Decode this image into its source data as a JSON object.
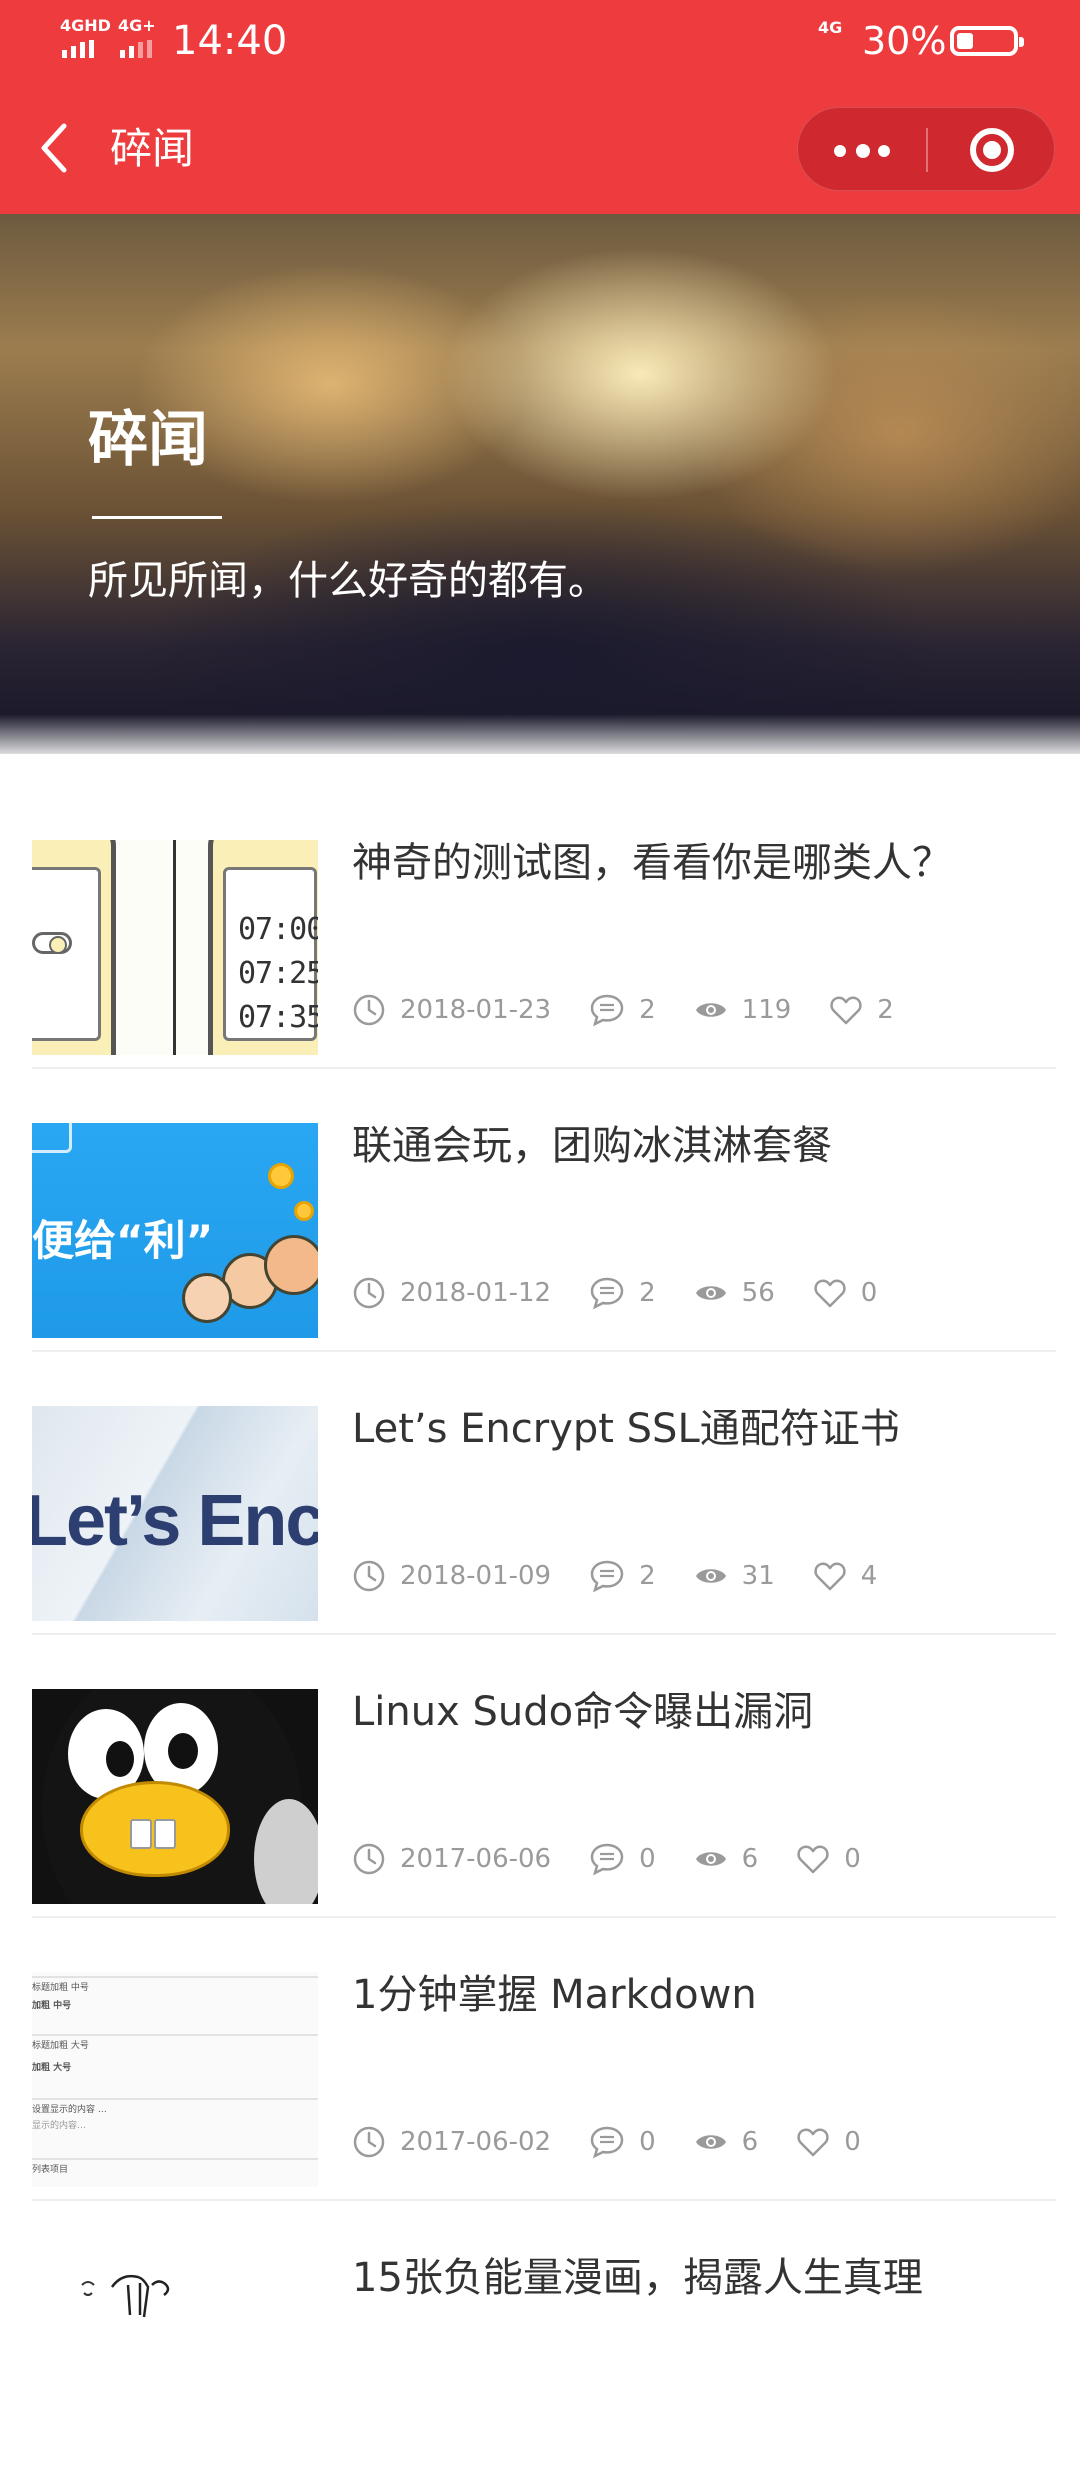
{
  "status_bar": {
    "signal_1": "4GHD",
    "signal_2": "4G+",
    "time": "14:40",
    "network_right": "4G",
    "battery_percent": "30%",
    "battery_level": 0.3
  },
  "nav": {
    "title": "碎闻"
  },
  "banner": {
    "title": "碎闻",
    "subtitle": "所见所闻，什么好奇的都有。"
  },
  "posts": [
    {
      "title": "神奇的测试图，看看你是哪类人？",
      "date": "2018-01-23",
      "comments": "2",
      "views": "119",
      "likes": "2",
      "thumb_clocks": [
        "07:00",
        "07:25",
        "07:35"
      ]
    },
    {
      "title": "联通会玩，团购冰淇淋套餐",
      "date": "2018-01-12",
      "comments": "2",
      "views": "56",
      "likes": "0",
      "thumb_text": "便给“利”"
    },
    {
      "title": "Let’s Encrypt SSL通配符证书",
      "date": "2018-01-09",
      "comments": "2",
      "views": "31",
      "likes": "4",
      "thumb_text": "Let’s Enc"
    },
    {
      "title": "Linux Sudo命令曝出漏洞",
      "date": "2017-06-06",
      "comments": "0",
      "views": "6",
      "likes": "0"
    },
    {
      "title": "1分钟掌握 Markdown",
      "date": "2017-06-02",
      "comments": "0",
      "views": "6",
      "likes": "0",
      "thumb_lines": [
        "标题加粗 中号",
        "加粗 中号",
        "标题加粗 大号",
        "加粗 大号",
        "设置显示的内容 …",
        "显示的内容…",
        "列表项目"
      ]
    },
    {
      "title": "15张负能量漫画，揭露人生真理"
    }
  ],
  "colors": {
    "brand_red": "#EE3B3E",
    "meta_gray": "#9a9a9a"
  }
}
